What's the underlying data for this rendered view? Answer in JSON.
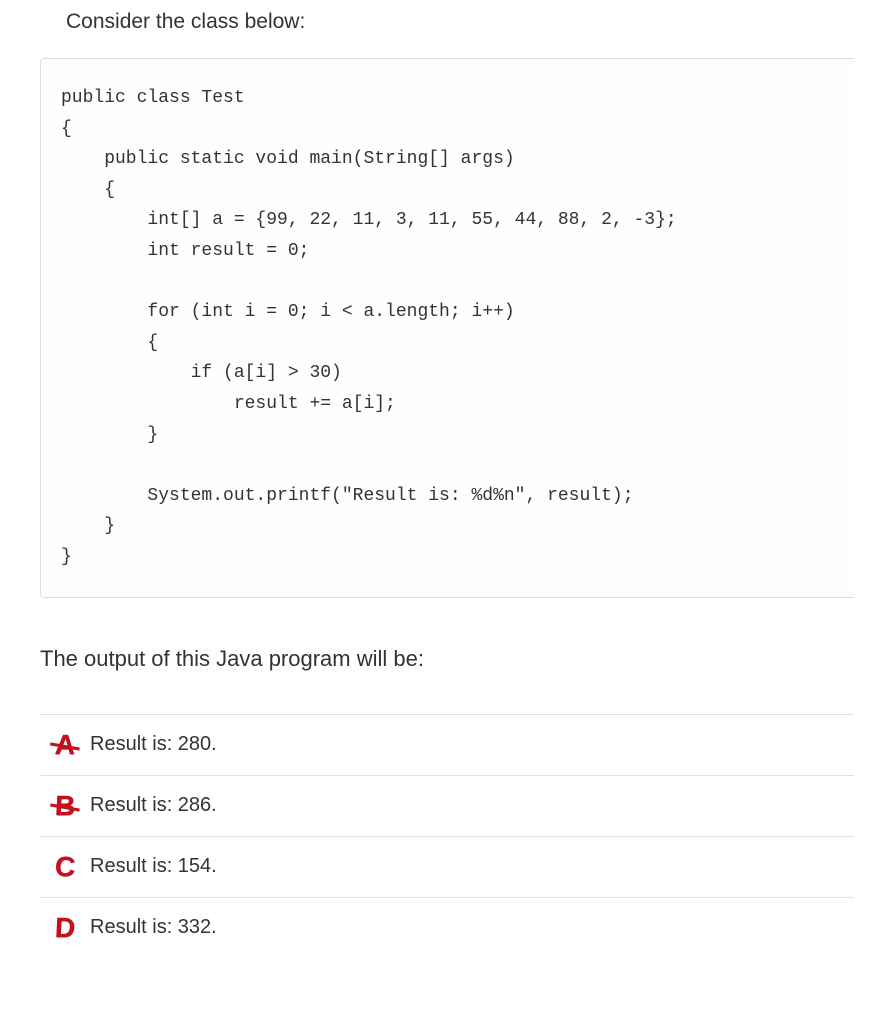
{
  "intro": "Consider the class below:",
  "code": "public class Test\n{\n    public static void main(String[] args)\n    {\n        int[] a = {99, 22, 11, 3, 11, 55, 44, 88, 2, -3};\n        int result = 0;\n\n        for (int i = 0; i < a.length; i++)\n        {\n            if (a[i] > 30)\n                result += a[i];\n        }\n\n        System.out.printf(\"Result is: %d%n\", result);\n    }\n}",
  "question": "The output of this Java program will be:",
  "options": [
    {
      "letter": "A",
      "text": "Result is: 280.",
      "strike": true
    },
    {
      "letter": "B",
      "text": "Result is: 286.",
      "strike": true
    },
    {
      "letter": "C",
      "text": "Result is: 154.",
      "strike": false
    },
    {
      "letter": "D",
      "text": "Result is: 332.",
      "strike": false
    }
  ]
}
